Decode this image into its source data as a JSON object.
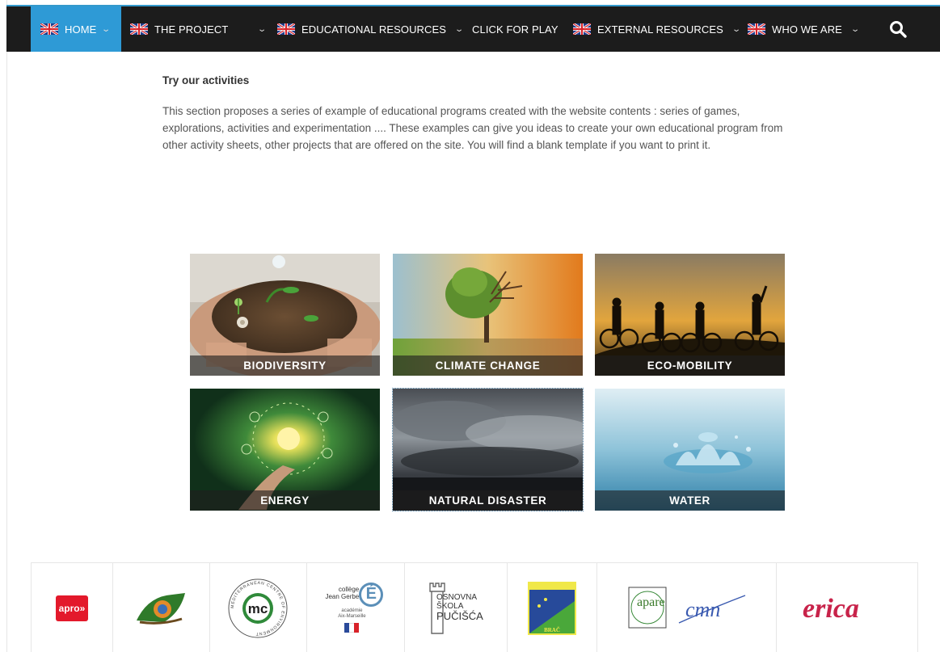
{
  "nav": {
    "items": [
      {
        "label": "HOME",
        "flag": true,
        "chevron": true,
        "active": true
      },
      {
        "label": "THE PROJECT",
        "flag": true,
        "chevron": true
      },
      {
        "label": "EDUCATIONAL RESOURCES",
        "flag": true,
        "chevron": true
      },
      {
        "label": "CLICK FOR PLAY",
        "flag": false,
        "chevron": false
      },
      {
        "label": "EXTERNAL RESOURCES",
        "flag": true,
        "chevron": true
      },
      {
        "label": "WHO WE ARE",
        "flag": true,
        "chevron": true
      }
    ],
    "search_icon": "search-icon",
    "flag_icon": "uk-flag-icon",
    "colors": {
      "bar": "#1c1c1c",
      "active": "#2e9ad6",
      "accent": "#3399cc"
    }
  },
  "intro": {
    "title": "Try our activities",
    "body": "This section proposes a series of example of educational programs created with the website contents : series of games, explorations, activities and experimentation .... These examples can give you ideas to create your own educational program from other activity sheets, other projects that are offered on the site. You will find a blank template if you want to print it."
  },
  "activities": [
    {
      "label": "BIODIVERSITY"
    },
    {
      "label": "CLIMATE CHANGE"
    },
    {
      "label": "ECO-MOBILITY"
    },
    {
      "label": "ENERGY"
    },
    {
      "label": "NATURAL DISASTER"
    },
    {
      "label": "WATER"
    }
  ],
  "partners": {
    "apro": "apro»",
    "mc": "mc",
    "mc_ring": "MEDITERRANEAN CENTRE OF ENVIRONMENT",
    "college_1": "collège",
    "college_2": "Jean Gerbe",
    "college_3": "académie",
    "college_4": "Aix-Marseille",
    "osnovna_1": "OSNOVNA",
    "osnovna_2": "ŠKOLA",
    "osnovna_3": "PUČIŠĆA",
    "brac": "BRAČ",
    "apare": "apare",
    "cmn": "cmn",
    "erica": "erica"
  }
}
